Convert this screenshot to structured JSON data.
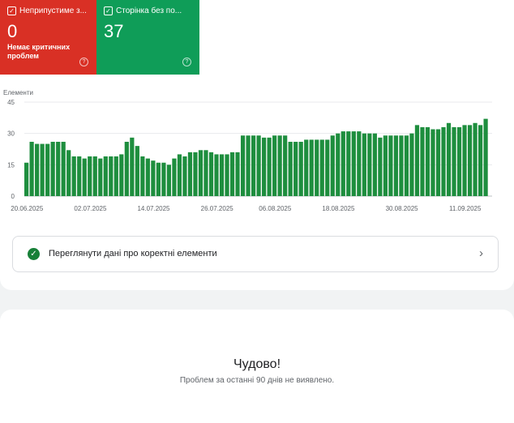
{
  "tiles": [
    {
      "label": "Неприпустиме з...",
      "value": "0",
      "desc": "Немає критичних проблем",
      "color": "#d93025"
    },
    {
      "label": "Сторінка без по...",
      "value": "37",
      "desc": "",
      "color": "#0f9d58"
    }
  ],
  "help_icon": "?",
  "chart_data": {
    "type": "bar",
    "ylabel": "Елементи",
    "ylim": [
      0,
      45
    ],
    "yticks": [
      0,
      15,
      30,
      45
    ],
    "xtick_labels": [
      "20.06.2025",
      "02.07.2025",
      "14.07.2025",
      "26.07.2025",
      "06.08.2025",
      "18.08.2025",
      "30.08.2025",
      "11.09.2025"
    ],
    "xtick_indices": [
      0,
      12,
      24,
      36,
      47,
      59,
      71,
      83
    ],
    "values": [
      16,
      26,
      25,
      25,
      25,
      26,
      26,
      26,
      22,
      19,
      19,
      18,
      19,
      19,
      18,
      19,
      19,
      19,
      20,
      26,
      28,
      24,
      19,
      18,
      17,
      16,
      16,
      15,
      18,
      20,
      19,
      21,
      21,
      22,
      22,
      21,
      20,
      20,
      20,
      21,
      21,
      29,
      29,
      29,
      29,
      28,
      28,
      29,
      29,
      29,
      26,
      26,
      26,
      27,
      27,
      27,
      27,
      27,
      29,
      30,
      31,
      31,
      31,
      31,
      30,
      30,
      30,
      28,
      29,
      29,
      29,
      29,
      29,
      30,
      34,
      33,
      33,
      32,
      32,
      33,
      35,
      33,
      33,
      34,
      34,
      35,
      34,
      37
    ],
    "bar_color": "#1e8e3e",
    "grid": true
  },
  "detail_row": {
    "label": "Переглянути дані про коректні елементи"
  },
  "summary": {
    "title": "Чудово!",
    "subtitle": "Проблем за останні 90 днів не виявлено."
  }
}
